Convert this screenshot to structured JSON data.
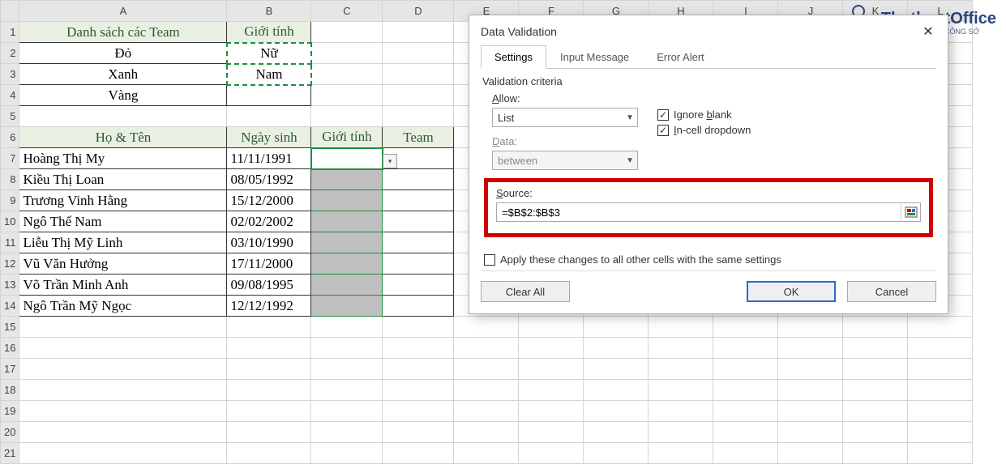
{
  "columns": [
    "A",
    "B",
    "C",
    "D",
    "E",
    "F",
    "G",
    "H",
    "I",
    "J",
    "K",
    "L"
  ],
  "row_count": 21,
  "table1": {
    "header": {
      "A": "Danh sách các Team",
      "B": "Giới tính"
    },
    "rows": [
      {
        "A": "Đỏ",
        "B": "Nữ"
      },
      {
        "A": "Xanh",
        "B": "Nam"
      },
      {
        "A": "Vàng",
        "B": ""
      }
    ]
  },
  "table2": {
    "header": {
      "A": "Họ & Tên",
      "B": "Ngày sinh",
      "C": "Giới tính",
      "D": "Team"
    },
    "rows": [
      {
        "A": "Hoàng Thị My",
        "B": "11/11/1991"
      },
      {
        "A": "Kiều Thị Loan",
        "B": "08/05/1992"
      },
      {
        "A": "Trương Vinh Hằng",
        "B": "15/12/2000"
      },
      {
        "A": "Ngô Thế Nam",
        "B": "02/02/2002"
      },
      {
        "A": "Liễu Thị Mỹ Linh",
        "B": "03/10/1990"
      },
      {
        "A": "Vũ Văn Hưởng",
        "B": "17/11/2000"
      },
      {
        "A": "Võ Trần Minh Anh",
        "B": "09/08/1995"
      },
      {
        "A": "Ngô Trần Mỹ Ngọc",
        "B": "12/12/1992"
      }
    ]
  },
  "dialog": {
    "title": "Data Validation",
    "tabs": [
      "Settings",
      "Input Message",
      "Error Alert"
    ],
    "active_tab": 0,
    "criteria_label": "Validation criteria",
    "allow_label": "Allow:",
    "allow_value": "List",
    "data_label": "Data:",
    "data_value": "between",
    "ignore_blank_label": "Ignore blank",
    "ignore_blank_checked": true,
    "incell_label": "In-cell dropdown",
    "incell_checked": true,
    "source_label": "Source:",
    "source_value": "=$B$2:$B$3",
    "apply_label": "Apply these changes to all other cells with the same settings",
    "apply_checked": false,
    "clear_label": "Clear All",
    "ok_label": "OK",
    "cancel_label": "Cancel"
  },
  "logo": {
    "name": "ThuthuatOffice",
    "sub": "TRỢ LÝ CỦA DÂN CÔNG SỞ",
    "magnifier": "🔍"
  }
}
